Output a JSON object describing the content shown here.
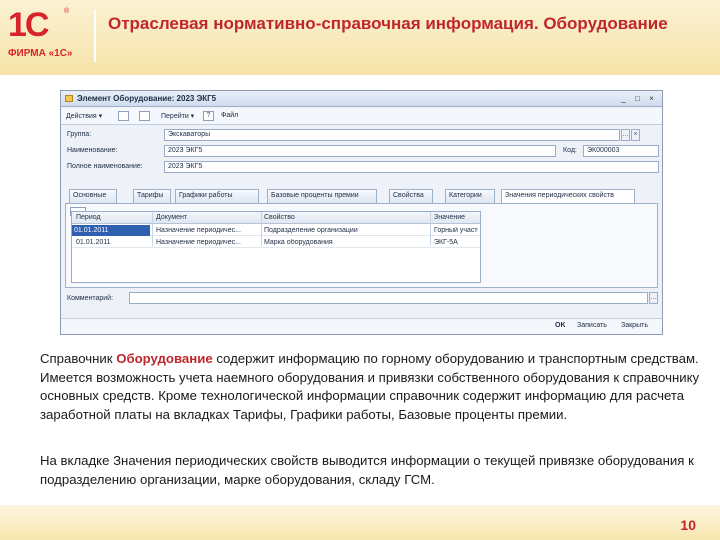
{
  "logo": {
    "mark": "1С",
    "reg": "®",
    "firm": "ФИРМА «1С»"
  },
  "title": "Отраслевая нормативно-справочная информация. Оборудование",
  "window": {
    "title": "Элемент Оборудование: 2023 ЭКГ5",
    "controls": {
      "minimize": "_",
      "maximize": "□",
      "close": "×"
    },
    "toolbar": {
      "actions": "Действия ▾",
      "goto": "Перейти ▾",
      "help": "?",
      "file": "Файл"
    },
    "fields": {
      "group_label": "Группа:",
      "group_value": "Экскаваторы",
      "group_btn": "...",
      "name_label": "Наименование:",
      "name_value": "2023 ЭКГ5",
      "code_label": "Код:",
      "code_value": "ЭК000003",
      "fullname_label": "Полное наименование:",
      "fullname_value": "2023 ЭКГ5",
      "comment_label": "Комментарий:"
    },
    "tabs": [
      "Основные",
      "Тарифы",
      "Графики работы",
      "Базовые проценты премии",
      "Свойства",
      "Категории",
      "Значения периодических свойств"
    ],
    "grid": {
      "columns": [
        "Период",
        "Документ",
        "Свойство",
        "Значение"
      ],
      "rows": [
        {
          "period": "01.01.2011",
          "document": "Назначение периодичес...",
          "property": "Подразделение организации",
          "value": "Горный участок"
        },
        {
          "period": "01.01.2011",
          "document": "Назначение периодичес...",
          "property": "Марка оборудования",
          "value": "ЭКГ-5А"
        }
      ]
    },
    "buttons": {
      "ok": "OK",
      "save": "Записать",
      "close": "Закрыть"
    }
  },
  "text": {
    "p1_a": "Справочник ",
    "p1_b": "Оборудование",
    "p1_c": " содержит информацию по горному оборудованию и транспортным средствам. Имеется возможность учета наемного оборудования и привязки собственного оборудования к справочнику основных средств. Кроме технологической информации справочник содержит информацию для расчета заработной платы на вкладках Тарифы, Графики работы, Базовые проценты премии.",
    "p2": "На вкладке Значения периодических свойств выводится информации о текущей привязке оборудования к подразделению организации, марке оборудования, складу ГСМ."
  },
  "page_number": "10"
}
